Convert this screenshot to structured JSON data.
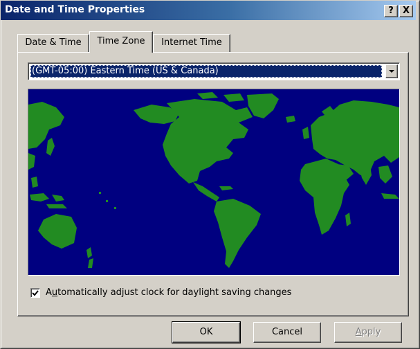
{
  "window": {
    "title": "Date and Time Properties",
    "help_button": "?",
    "close_button": "X"
  },
  "tabs": [
    {
      "label": "Date & Time",
      "active": false
    },
    {
      "label": "Time Zone",
      "active": true
    },
    {
      "label": "Internet Time",
      "active": false
    }
  ],
  "timezone": {
    "selected": "(GMT-05:00) Eastern Time (US & Canada)"
  },
  "map": {
    "ocean_color": "#000080",
    "land_color": "#228b22",
    "icon": "world-map"
  },
  "daylight_checkbox": {
    "checked": true,
    "label_prefix": "A",
    "label_accel": "u",
    "label_rest": "tomatically adjust clock for daylight saving changes"
  },
  "buttons": {
    "ok": "OK",
    "cancel": "Cancel",
    "apply_accel": "A",
    "apply_rest": "pply"
  },
  "colors": {
    "dialog_face": "#d4d0c8",
    "title_active": "#0a246a",
    "selection": "#0a246a"
  }
}
